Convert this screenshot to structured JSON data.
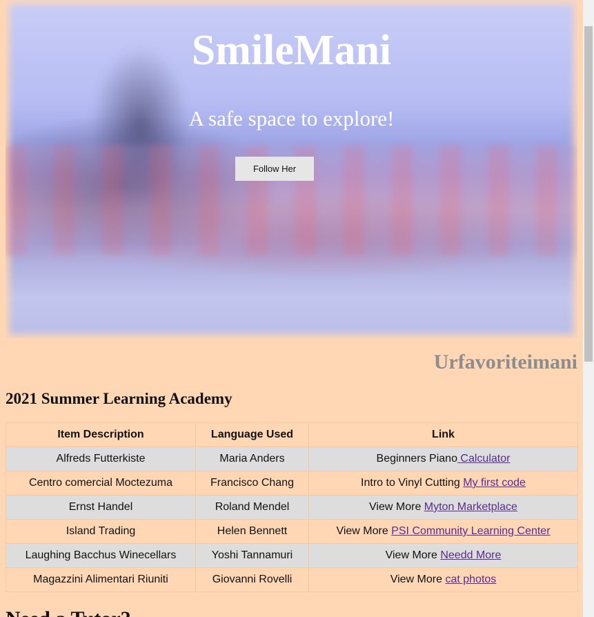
{
  "hero": {
    "title": "SmileMani",
    "subtitle": "A safe space to explore!",
    "button_label": "Follow Her"
  },
  "handle": "Urfavoriteimani",
  "section": {
    "title": "2021 Summer Learning Academy"
  },
  "table": {
    "headers": [
      "Item Description",
      "Language Used",
      "Link"
    ],
    "rows": [
      {
        "item": "Alfreds Futterkiste",
        "language": "Maria Anders",
        "link_prefix": "Beginners Piano",
        "link_text": " Calculator"
      },
      {
        "item": "Centro comercial Moctezuma",
        "language": "Francisco Chang",
        "link_prefix": "Intro to Vinyl Cutting ",
        "link_text": "My first code"
      },
      {
        "item": "Ernst Handel",
        "language": "Roland Mendel",
        "link_prefix": "View More ",
        "link_text": "Myton Marketplace"
      },
      {
        "item": "Island Trading",
        "language": "Helen Bennett",
        "link_prefix": "View More ",
        "link_text": "PSI Community Learning Center"
      },
      {
        "item": "Laughing Bacchus Winecellars",
        "language": "Yoshi Tannamuri",
        "link_prefix": "View More ",
        "link_text": "Needd More"
      },
      {
        "item": "Magazzini Alimentari Riuniti",
        "language": "Giovanni Rovelli",
        "link_prefix": "View More ",
        "link_text": "cat photos"
      }
    ]
  },
  "next_section": {
    "title": "Need a Tutor?"
  },
  "colors": {
    "page_background": "#ffd7b5",
    "row_alt": "#dddddd",
    "link": "#5a2b8e",
    "handle": "#8d8d8d"
  }
}
